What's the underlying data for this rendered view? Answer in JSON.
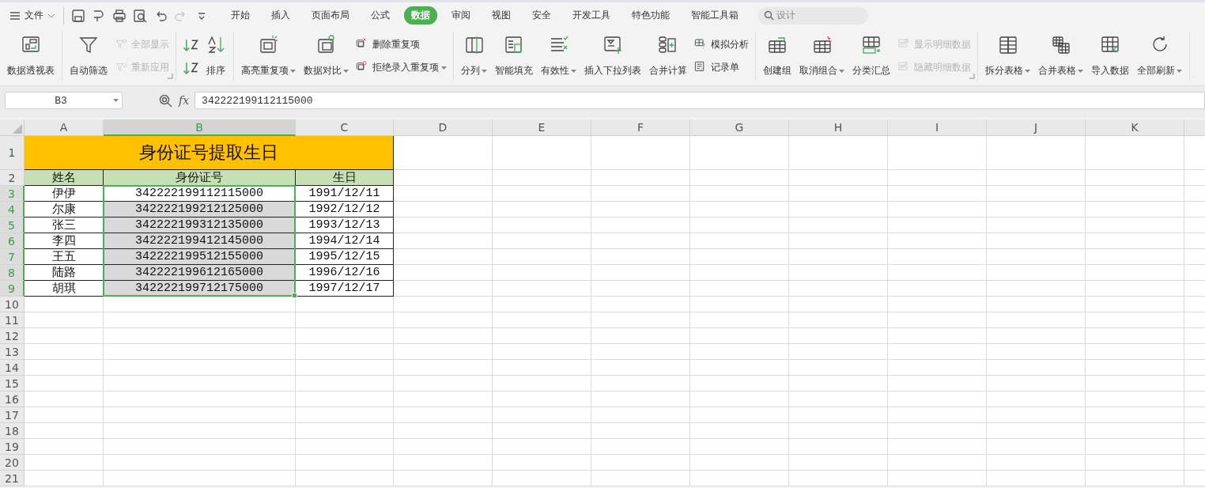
{
  "file_menu": {
    "label": "文件"
  },
  "quick_access": [
    {
      "disabled": false
    },
    {
      "disabled": false
    },
    {
      "disabled": false
    },
    {
      "disabled": false
    },
    {
      "disabled": false
    },
    {
      "disabled": true
    },
    {
      "disabled": false
    }
  ],
  "tabs": [
    {
      "label": "开始",
      "selected": false
    },
    {
      "label": "插入",
      "selected": false
    },
    {
      "label": "页面布局",
      "selected": false
    },
    {
      "label": "公式",
      "selected": false
    },
    {
      "label": "数据",
      "selected": true
    },
    {
      "label": "审阅",
      "selected": false
    },
    {
      "label": "视图",
      "selected": false
    },
    {
      "label": "安全",
      "selected": false
    },
    {
      "label": "开发工具",
      "selected": false
    },
    {
      "label": "特色功能",
      "selected": false
    },
    {
      "label": "智能工具箱",
      "selected": false
    }
  ],
  "search": {
    "placeholder": "设计"
  },
  "ribbon": {
    "groups": [
      {
        "items": [
          {
            "kind": "large",
            "label": "数据透视表",
            "dropdown": false,
            "disabled": false
          }
        ]
      },
      {
        "launcher": true,
        "items": [
          {
            "kind": "large",
            "label": "自动筛选",
            "dropdown": false,
            "disabled": false
          },
          {
            "kind": "stack",
            "items": [
              {
                "label": "全部显示",
                "dropdown": false,
                "disabled": true
              },
              {
                "label": "重新应用",
                "dropdown": false,
                "disabled": true
              }
            ]
          }
        ]
      },
      {
        "items": [
          {
            "kind": "stack",
            "items": [
              {
                "dropdown": false,
                "disabled": false
              },
              {
                "dropdown": false,
                "disabled": false
              }
            ]
          },
          {
            "kind": "large",
            "label": "排序",
            "dropdown": false,
            "disabled": false
          }
        ]
      },
      {
        "items": [
          {
            "kind": "large",
            "label": "高亮重复项",
            "dropdown": true,
            "disabled": false
          },
          {
            "kind": "large",
            "label": "数据对比",
            "dropdown": true,
            "disabled": false
          },
          {
            "kind": "stack",
            "items": [
              {
                "label": "删除重复项",
                "dropdown": false,
                "disabled": false
              },
              {
                "label": "拒绝录入重复项",
                "dropdown": true,
                "disabled": false
              }
            ]
          }
        ]
      },
      {
        "items": [
          {
            "kind": "large",
            "label": "分列",
            "dropdown": true,
            "disabled": false
          },
          {
            "kind": "large",
            "label": "智能填充",
            "dropdown": false,
            "disabled": false
          },
          {
            "kind": "large",
            "label": "有效性",
            "dropdown": true,
            "disabled": false
          },
          {
            "kind": "large",
            "label": "插入下拉列表",
            "dropdown": false,
            "disabled": false
          },
          {
            "kind": "large",
            "label": "合并计算",
            "dropdown": false,
            "disabled": false
          },
          {
            "kind": "stack",
            "items": [
              {
                "label": "模拟分析",
                "dropdown": false,
                "disabled": false
              },
              {
                "label": "记录单",
                "dropdown": false,
                "disabled": false
              }
            ]
          }
        ]
      },
      {
        "launcher": true,
        "items": [
          {
            "kind": "large",
            "label": "创建组",
            "dropdown": false,
            "disabled": false
          },
          {
            "kind": "large",
            "label": "取消组合",
            "dropdown": true,
            "disabled": false
          },
          {
            "kind": "large",
            "label": "分类汇总",
            "dropdown": false,
            "disabled": false
          },
          {
            "kind": "stack",
            "items": [
              {
                "label": "显示明细数据",
                "dropdown": false,
                "disabled": true
              },
              {
                "label": "隐藏明细数据",
                "dropdown": false,
                "disabled": true
              }
            ]
          }
        ]
      },
      {
        "items": [
          {
            "kind": "large",
            "label": "拆分表格",
            "dropdown": true,
            "disabled": false
          },
          {
            "kind": "large",
            "label": "合并表格",
            "dropdown": true,
            "disabled": false
          },
          {
            "kind": "large",
            "label": "导入数据",
            "dropdown": false,
            "disabled": false
          },
          {
            "kind": "large",
            "label": "全部刷新",
            "dropdown": true,
            "disabled": false
          }
        ]
      }
    ]
  },
  "formula_bar": {
    "name_box": "B3",
    "function_label": "fx",
    "value": "342222199112115000"
  },
  "sheet": {
    "columns": [
      {
        "label": "A",
        "selected": false
      },
      {
        "label": "B",
        "selected": true
      },
      {
        "label": "C",
        "selected": false
      },
      {
        "label": "D",
        "selected": false
      },
      {
        "label": "E",
        "selected": false
      },
      {
        "label": "F",
        "selected": false
      },
      {
        "label": "G",
        "selected": false
      },
      {
        "label": "H",
        "selected": false
      },
      {
        "label": "I",
        "selected": false
      },
      {
        "label": "J",
        "selected": false
      },
      {
        "label": "K",
        "selected": false
      }
    ],
    "rows": [
      {
        "label": "1",
        "selected": false
      },
      {
        "label": "2",
        "selected": false
      },
      {
        "label": "3",
        "selected": true
      },
      {
        "label": "4",
        "selected": true
      },
      {
        "label": "5",
        "selected": true
      },
      {
        "label": "6",
        "selected": true
      },
      {
        "label": "7",
        "selected": true
      },
      {
        "label": "8",
        "selected": true
      },
      {
        "label": "9",
        "selected": true
      },
      {
        "label": "10",
        "selected": false
      },
      {
        "label": "11",
        "selected": false
      },
      {
        "label": "12",
        "selected": false
      },
      {
        "label": "13",
        "selected": false
      },
      {
        "label": "14",
        "selected": false
      },
      {
        "label": "15",
        "selected": false
      },
      {
        "label": "16",
        "selected": false
      },
      {
        "label": "17",
        "selected": false
      },
      {
        "label": "18",
        "selected": false
      },
      {
        "label": "19",
        "selected": false
      },
      {
        "label": "20",
        "selected": false
      },
      {
        "label": "21",
        "selected": false
      }
    ],
    "table": {
      "title": "身份证号提取生日",
      "headers": [
        "姓名",
        "身份证号",
        "生日"
      ],
      "records": [
        {
          "cells": [
            "伊伊",
            "342222199112115000",
            "1991/12/11"
          ],
          "active": true
        },
        {
          "cells": [
            "尔康",
            "342222199212125000",
            "1992/12/12"
          ],
          "active": false
        },
        {
          "cells": [
            "张三",
            "342222199312135000",
            "1993/12/13"
          ],
          "active": false
        },
        {
          "cells": [
            "李四",
            "342222199412145000",
            "1994/12/14"
          ],
          "active": false
        },
        {
          "cells": [
            "王五",
            "342222199512155000",
            "1995/12/15"
          ],
          "active": false
        },
        {
          "cells": [
            "陆路",
            "342222199612165000",
            "1996/12/16"
          ],
          "active": false
        },
        {
          "cells": [
            "胡琪",
            "342222199712175000",
            "1997/12/17"
          ],
          "active": false
        }
      ]
    }
  }
}
